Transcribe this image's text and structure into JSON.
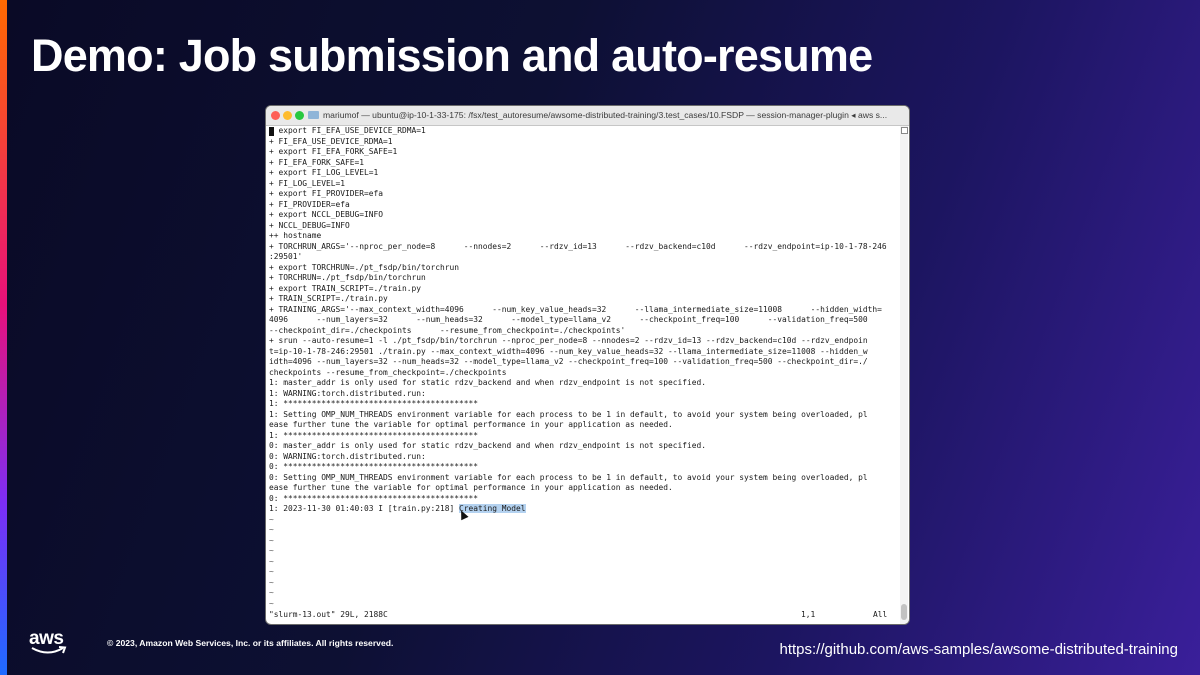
{
  "slide": {
    "title": "Demo: Job submission and auto-resume",
    "copyright": "© 2023, Amazon Web Services, Inc. or its affiliates. All rights reserved.",
    "url": "https://github.com/aws-samples/awsome-distributed-training",
    "logo_text": "aws",
    "colors": {
      "background": "#0d1033",
      "accent_start": "#ff6a00",
      "accent_end": "#1e6bff"
    }
  },
  "terminal": {
    "window_title": "mariumof — ubuntu@ip-10-1-33-175: /fsx/test_autoresume/awsome-distributed-training/3.test_cases/10.FSDP — session-manager-plugin ◂ aws s...",
    "lines": [
      "  export FI_EFA_USE_DEVICE_RDMA=1",
      "+ FI_EFA_USE_DEVICE_RDMA=1",
      "+ export FI_EFA_FORK_SAFE=1",
      "+ FI_EFA_FORK_SAFE=1",
      "+ export FI_LOG_LEVEL=1",
      "+ FI_LOG_LEVEL=1",
      "+ export FI_PROVIDER=efa",
      "+ FI_PROVIDER=efa",
      "+ export NCCL_DEBUG=INFO",
      "+ NCCL_DEBUG=INFO",
      "++ hostname",
      "+ TORCHRUN_ARGS='--nproc_per_node=8      --nnodes=2      --rdzv_id=13      --rdzv_backend=c10d      --rdzv_endpoint=ip-10-1-78-246",
      ":29501'",
      "+ export TORCHRUN=./pt_fsdp/bin/torchrun",
      "+ TORCHRUN=./pt_fsdp/bin/torchrun",
      "+ export TRAIN_SCRIPT=./train.py",
      "+ TRAIN_SCRIPT=./train.py",
      "+ TRAINING_ARGS='--max_context_width=4096      --num_key_value_heads=32      --llama_intermediate_size=11008      --hidden_width=",
      "4096      --num_layers=32      --num_heads=32      --model_type=llama_v2      --checkpoint_freq=100      --validation_freq=500",
      "--checkpoint_dir=./checkpoints      --resume_from_checkpoint=./checkpoints'",
      "+ srun --auto-resume=1 -l ./pt_fsdp/bin/torchrun --nproc_per_node=8 --nnodes=2 --rdzv_id=13 --rdzv_backend=c10d --rdzv_endpoin",
      "t=ip-10-1-78-246:29501 ./train.py --max_context_width=4096 --num_key_value_heads=32 --llama_intermediate_size=11008 --hidden_w",
      "idth=4096 --num_layers=32 --num_heads=32 --model_type=llama_v2 --checkpoint_freq=100 --validation_freq=500 --checkpoint_dir=./",
      "checkpoints --resume_from_checkpoint=./checkpoints",
      "1: master_addr is only used for static rdzv_backend and when rdzv_endpoint is not specified.",
      "1: WARNING:torch.distributed.run:",
      "1: *****************************************",
      "1: Setting OMP_NUM_THREADS environment variable for each process to be 1 in default, to avoid your system being overloaded, pl",
      "ease further tune the variable for optimal performance in your application as needed.",
      "1: *****************************************",
      "0: master_addr is only used for static rdzv_backend and when rdzv_endpoint is not specified.",
      "0: WARNING:torch.distributed.run:",
      "0: *****************************************",
      "0: Setting OMP_NUM_THREADS environment variable for each process to be 1 in default, to avoid your system being overloaded, pl",
      "ease further tune the variable for optimal performance in your application as needed.",
      "0: *****************************************"
    ],
    "last_line_prefix": "1: 2023-11-30 01:40:03 I [train.py:218] ",
    "last_line_highlight": "Creating Model",
    "tilde_lines": [
      "~",
      "~",
      "~",
      "~",
      "~",
      "~",
      "~",
      "~",
      "~"
    ],
    "status_file": "\"slurm-13.out\" 29L, 2188C",
    "status_position": "1,1",
    "status_percent": "All"
  }
}
